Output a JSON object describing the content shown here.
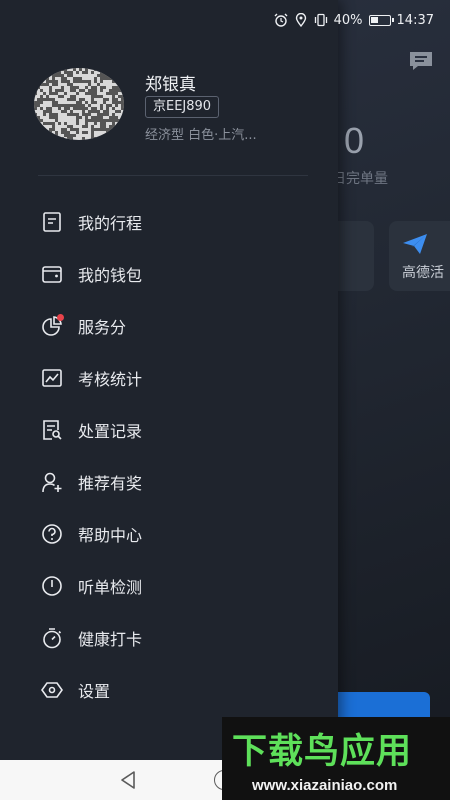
{
  "status_bar": {
    "battery_percent": "40%",
    "battery_level": 0.4,
    "time": "14:37",
    "icons": [
      "alarm-icon",
      "location-icon",
      "vibrate-icon"
    ]
  },
  "background": {
    "order_count": "0",
    "order_label": "日完单量",
    "card2_label": "高德活",
    "accent_color": "#1b6fd6"
  },
  "profile": {
    "name": "郑银真",
    "plate": "京EEJ890",
    "car_info": "经济型 白色·上汽..."
  },
  "menu": [
    {
      "label": "我的行程",
      "icon": "trip-list-icon"
    },
    {
      "label": "我的钱包",
      "icon": "wallet-icon"
    },
    {
      "label": "服务分",
      "icon": "pie-chart-icon",
      "badge": true
    },
    {
      "label": "考核统计",
      "icon": "line-chart-icon"
    },
    {
      "label": "处置记录",
      "icon": "record-icon"
    },
    {
      "label": "推荐有奖",
      "icon": "add-user-icon"
    },
    {
      "label": "帮助中心",
      "icon": "help-icon"
    },
    {
      "label": "听单检测",
      "icon": "clock-icon"
    },
    {
      "label": "健康打卡",
      "icon": "stopwatch-icon"
    },
    {
      "label": "设置",
      "icon": "settings-icon"
    }
  ],
  "watermark": {
    "title": "下载鸟应用",
    "url": "www.xiazainiao.com"
  },
  "colors": {
    "drawer_bg": "#1f242d",
    "badge_red": "#e8434b",
    "watermark_green": "#5ee05a"
  }
}
